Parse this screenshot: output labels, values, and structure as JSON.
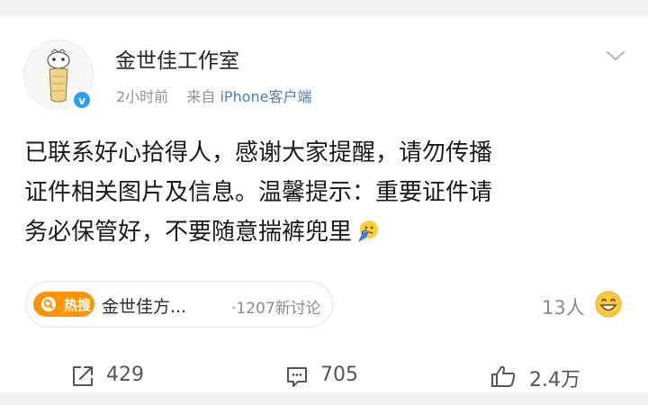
{
  "post": {
    "author": "金世佳工作室",
    "time": "2小时前",
    "via_prefix": "来自",
    "via_device": "iPhone客户端",
    "text_lines": [
      "已联系好心拾得人，感谢大家提醒，请勿传播",
      "证件相关图片及信息。温馨提示：重要证件请",
      "务必保管好，不要随意揣裤兜里"
    ],
    "trailing_emoji": "facepalm-emoji"
  },
  "trending": {
    "badge": "热搜",
    "topic": "金世佳方...",
    "discussions": "·1207新讨论"
  },
  "reactions": {
    "count": "13人",
    "emoji": "grinning-emoji"
  },
  "actions": {
    "repost": "429",
    "comment": "705",
    "like": "2.4万"
  },
  "colors": {
    "verified": "#2f9df4",
    "hot_badge": "#ff9406",
    "source_link": "#507daf"
  }
}
